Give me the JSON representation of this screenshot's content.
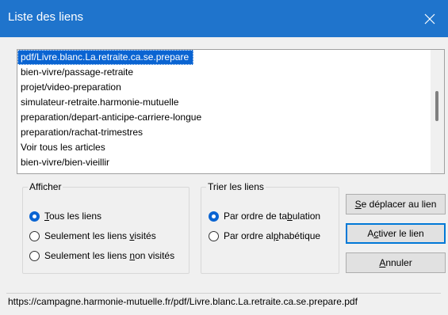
{
  "window": {
    "title": "Liste des liens",
    "close_icon": "close-icon"
  },
  "links_list": {
    "selected_index": 0,
    "items": [
      "pdf/Livre.blanc.La.retraite.ca.se.prepare",
      "bien-vivre/passage-retraite",
      "projet/video-preparation",
      "simulateur-retraite.harmonie-mutuelle",
      "preparation/depart-anticipe-carriere-longue",
      "preparation/rachat-trimestres",
      "Voir tous les articles",
      "bien-vivre/bien-vieillir"
    ]
  },
  "afficher": {
    "legend": "Afficher",
    "options": [
      {
        "pre": "",
        "key": "T",
        "post": "ous les liens",
        "checked": true
      },
      {
        "pre": "Seulement les liens ",
        "key": "v",
        "post": "isités",
        "checked": false
      },
      {
        "pre": "Seulement les liens ",
        "key": "n",
        "post": "on visités",
        "checked": false
      }
    ]
  },
  "trier": {
    "legend": "Trier les liens",
    "options": [
      {
        "pre": "Par ordre de ta",
        "key": "b",
        "post": "ulation",
        "checked": true
      },
      {
        "pre": "Par ordre al",
        "key": "p",
        "post": "habétique",
        "checked": false
      }
    ]
  },
  "buttons": {
    "move": {
      "pre": "",
      "key": "S",
      "post": "e déplacer au lien"
    },
    "activate": {
      "pre": "A",
      "key": "c",
      "post": "tiver le lien"
    },
    "cancel": {
      "pre": "",
      "key": "A",
      "post": "nnuler"
    }
  },
  "status_url": "https://campagne.harmonie-mutuelle.fr/pdf/Livre.blanc.La.retraite.ca.se.prepare.pdf",
  "colors": {
    "titlebar": "#1f74cc",
    "selection": "#0a64d2"
  }
}
